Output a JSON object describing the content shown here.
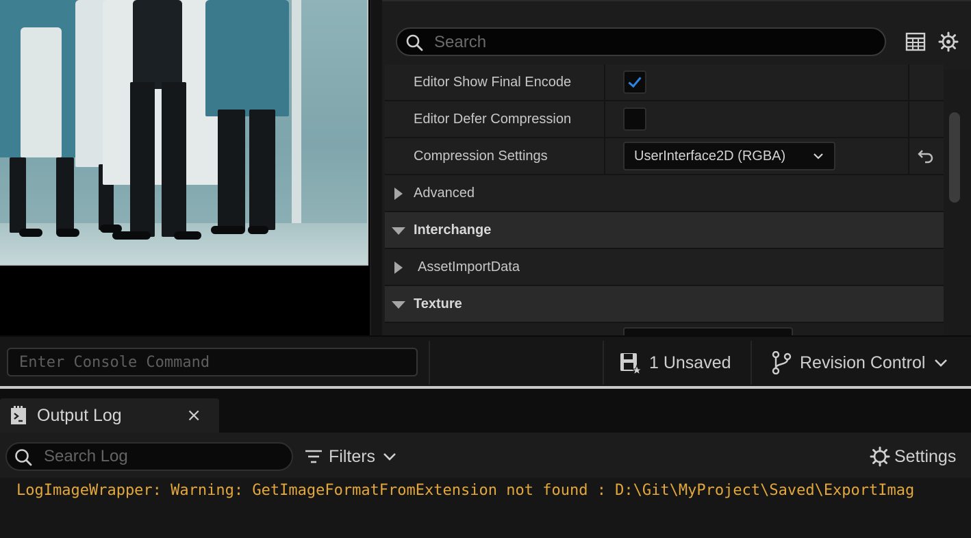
{
  "details": {
    "search_placeholder": "Search",
    "toolbar_icons": [
      "table-view-icon",
      "gear-icon"
    ],
    "rows": [
      {
        "label": "Editor Show Final Encode",
        "type": "checkbox",
        "checked": true
      },
      {
        "label": "Editor Defer Compression",
        "type": "checkbox",
        "checked": false
      },
      {
        "label": "Compression Settings",
        "type": "combo",
        "value": "UserInterface2D (RGBA)",
        "has_reset": true
      },
      {
        "label": "Advanced",
        "type": "group",
        "expanded": false
      },
      {
        "label": "Interchange",
        "type": "section",
        "expanded": true
      },
      {
        "label": "AssetImportData",
        "type": "group",
        "expanded": false
      },
      {
        "label": "Texture",
        "type": "section",
        "expanded": true
      }
    ]
  },
  "statusbar": {
    "console_placeholder": "Enter Console Command",
    "unsaved_label": "1 Unsaved",
    "revision_control_label": "Revision Control"
  },
  "output_log": {
    "tab_label": "Output Log",
    "close_glyph": "×",
    "search_placeholder": "Search Log",
    "filters_label": "Filters",
    "settings_label": "Settings",
    "lines": [
      {
        "text": "LogImageWrapper: Warning: GetImageFormatFromExtension not found : D:\\Git\\MyProject\\Saved\\ExportImag",
        "color": "#e3a73a"
      }
    ]
  },
  "colors": {
    "accent_check": "#2d83e0",
    "warning_text": "#e3a73a"
  }
}
